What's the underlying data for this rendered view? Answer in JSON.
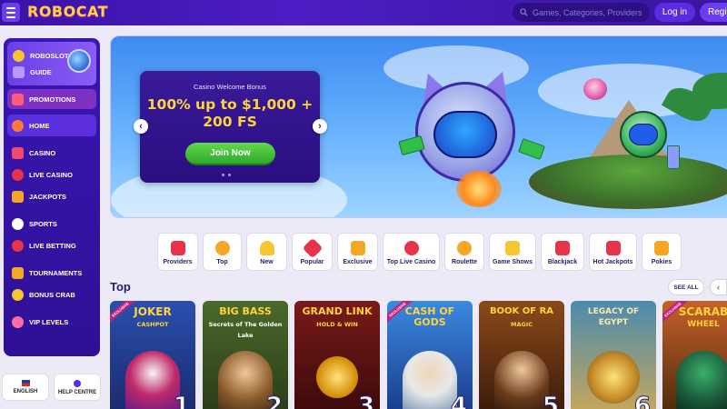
{
  "header": {
    "logo_text": "ROBOCAT",
    "search_placeholder": "Games, Categories, Providers",
    "login_label": "Log in",
    "register_label": "Regis"
  },
  "sidebar": {
    "promo_items": [
      {
        "label": "ROBOSLOT",
        "icon": "robot-coin-icon"
      },
      {
        "label": "GUIDE",
        "icon": "guide-book-icon"
      }
    ],
    "items": [
      {
        "label": "PROMOTIONS",
        "icon": "gift-icon",
        "active": false
      },
      {
        "label": "HOME",
        "icon": "home-icon",
        "active": true
      },
      {
        "label": "CASINO",
        "icon": "cards-icon",
        "active": false
      },
      {
        "label": "LIVE CASINO",
        "icon": "roulette-icon",
        "active": false
      },
      {
        "label": "JACKPOTS",
        "icon": "jackpot-icon",
        "active": false
      },
      {
        "label": "SPORTS",
        "icon": "ball-icon",
        "active": false
      },
      {
        "label": "LIVE BETTING",
        "icon": "live-icon",
        "active": false
      },
      {
        "label": "TOURNAMENTS",
        "icon": "trophy-icon",
        "active": false
      },
      {
        "label": "BONUS CRAB",
        "icon": "claw-icon",
        "active": false
      },
      {
        "label": "VIP LEVELS",
        "icon": "vip-icon",
        "active": false
      }
    ],
    "language_label": "ENGLISH",
    "help_label": "HELP CENTRE"
  },
  "banner": {
    "subtitle": "Casino Welcome Bonus",
    "title_line1": "100% up to $1,000 +",
    "title_line2": "200 FS",
    "cta_label": "Join Now",
    "prev_arrow": "‹",
    "next_arrow": "›"
  },
  "categories": [
    {
      "label": "Providers",
      "icon": "providers-icon",
      "color": "#e8344a"
    },
    {
      "label": "Top",
      "icon": "medal-icon",
      "color": "#f5a623"
    },
    {
      "label": "New",
      "icon": "bell-icon",
      "color": "#f7c531"
    },
    {
      "label": "Popular",
      "icon": "star-icon",
      "color": "#e8344a"
    },
    {
      "label": "Exclusive",
      "icon": "diamond-icon",
      "color": "#f5a623"
    },
    {
      "label": "Top Live Casino",
      "icon": "roulette-icon",
      "color": "#e8344a"
    },
    {
      "label": "Roulette",
      "icon": "roulette-wheel-icon",
      "color": "#f5a623"
    },
    {
      "label": "Game Shows",
      "icon": "microphone-icon",
      "color": "#f7c531"
    },
    {
      "label": "Blackjack",
      "icon": "playing-cards-icon",
      "color": "#e8344a"
    },
    {
      "label": "Hot Jackpots",
      "icon": "seven-icon",
      "color": "#e8344a"
    },
    {
      "label": "Pokies",
      "icon": "slot-machine-icon",
      "color": "#f5a623"
    }
  ],
  "top_section": {
    "title": "Top",
    "see_all_label": "SEE ALL",
    "prev_label": "‹"
  },
  "games": [
    {
      "name": "JOKER",
      "sub": "CASHPOT",
      "rank": "1",
      "badge": "EXCLUSIVE",
      "bg": "#2a4fb0",
      "fg": "#ffd43b"
    },
    {
      "name": "BIG BASS",
      "sub": "Secrets of The Golden Lake",
      "rank": "2",
      "badge": "",
      "bg": "#3c5a2a",
      "fg": "#ffd43b"
    },
    {
      "name": "GRAND LINK",
      "sub": "HOLD & WIN",
      "rank": "3",
      "badge": "",
      "bg": "#6a1a1a",
      "fg": "#ffd43b"
    },
    {
      "name": "CASH OF GODS",
      "sub": "",
      "rank": "4",
      "badge": "EXCLUSIVE",
      "bg": "#2a6ab0",
      "fg": "#ffd43b"
    },
    {
      "name": "BOOK OF RA",
      "sub": "MAGIC",
      "rank": "5",
      "badge": "",
      "bg": "#7a3a12",
      "fg": "#ffd43b"
    },
    {
      "name": "LEGACY OF EGYPT",
      "sub": "",
      "rank": "6",
      "badge": "",
      "bg": "#3a6a8a",
      "fg": "#ffe9a8"
    },
    {
      "name": "SCARAB",
      "sub": "WHEEL",
      "rank": "",
      "badge": "EXCLUSIVE",
      "bg": "#7a4a12",
      "fg": "#ffd43b"
    }
  ]
}
